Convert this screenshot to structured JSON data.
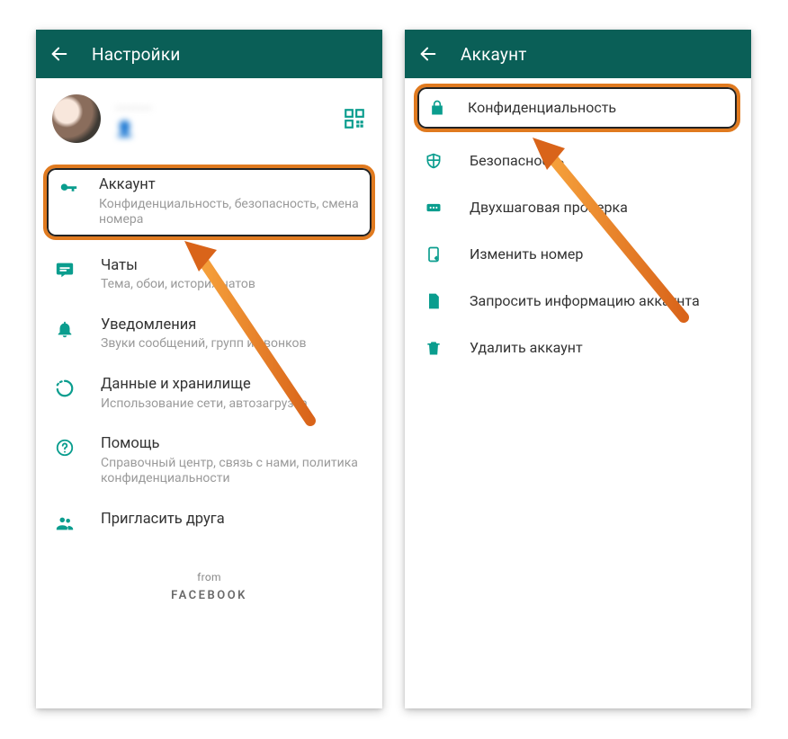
{
  "left": {
    "title": "Настройки",
    "profile": {
      "name": "········",
      "status": "👤"
    },
    "items": [
      {
        "key": "account",
        "label": "Аккаунт",
        "desc": "Конфиденциальность, безопасность, смена номера",
        "highlight": true
      },
      {
        "key": "chats",
        "label": "Чаты",
        "desc": "Тема, обои, история чатов"
      },
      {
        "key": "notif",
        "label": "Уведомления",
        "desc": "Звуки сообщений, групп и звонков"
      },
      {
        "key": "data",
        "label": "Данные и хранилище",
        "desc": "Использование сети, автозагрузка"
      },
      {
        "key": "help",
        "label": "Помощь",
        "desc": "Справочный центр, связь с нами, политика конфиденциальности"
      },
      {
        "key": "invite",
        "label": "Пригласить друга",
        "desc": ""
      }
    ],
    "footer_from": "from",
    "footer_brand": "FACEBOOK"
  },
  "right": {
    "title": "Аккаунт",
    "items": [
      {
        "key": "privacy",
        "label": "Конфиденциальность",
        "highlight": true
      },
      {
        "key": "security",
        "label": "Безопасность"
      },
      {
        "key": "twostep",
        "label": "Двухшаговая проверка"
      },
      {
        "key": "change",
        "label": "Изменить номер"
      },
      {
        "key": "request",
        "label": "Запросить информацию аккаунта"
      },
      {
        "key": "delete",
        "label": "Удалить аккаунт"
      }
    ]
  }
}
